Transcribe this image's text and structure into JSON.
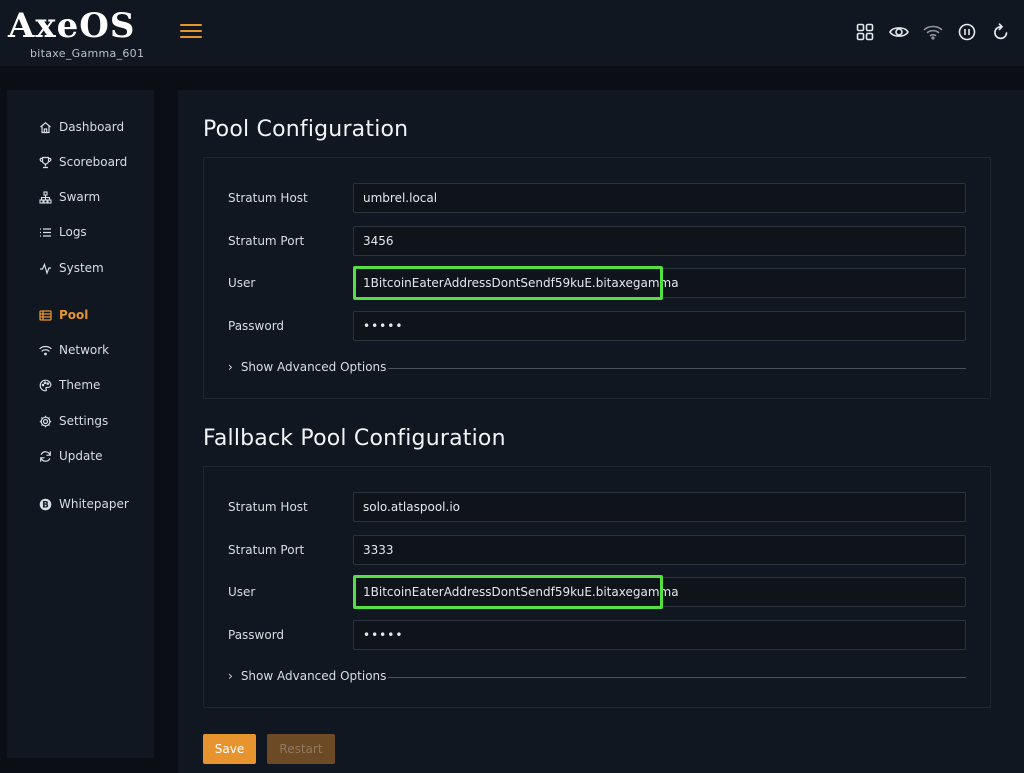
{
  "header": {
    "logo_text": "AxeOS",
    "device_name": "bitaxe_Gamma_601",
    "icons": [
      "menu-icon",
      "grid-icon",
      "eye-icon",
      "wifi-icon",
      "pause-icon",
      "refresh-icon"
    ]
  },
  "sidebar": {
    "items": [
      {
        "label": "Dashboard",
        "icon": "home-icon"
      },
      {
        "label": "Scoreboard",
        "icon": "trophy-icon"
      },
      {
        "label": "Swarm",
        "icon": "sitemap-icon"
      },
      {
        "label": "Logs",
        "icon": "list-icon"
      },
      {
        "label": "System",
        "icon": "activity-icon"
      },
      {
        "label": "Pool",
        "icon": "server-icon",
        "active": true
      },
      {
        "label": "Network",
        "icon": "wifi-icon"
      },
      {
        "label": "Theme",
        "icon": "palette-icon"
      },
      {
        "label": "Settings",
        "icon": "gear-icon"
      },
      {
        "label": "Update",
        "icon": "sync-icon"
      },
      {
        "label": "Whitepaper",
        "icon": "bitcoin-icon"
      }
    ]
  },
  "pool": {
    "title": "Pool Configuration",
    "stratum_host_label": "Stratum Host",
    "stratum_host": "umbrel.local",
    "stratum_port_label": "Stratum Port",
    "stratum_port": "3456",
    "user_label": "User",
    "user": "1BitcoinEaterAddressDontSendf59kuE.bitaxegamma",
    "password_label": "Password",
    "password": "•••••",
    "advanced_label": "Show Advanced Options"
  },
  "fallback": {
    "title": "Fallback Pool Configuration",
    "stratum_host_label": "Stratum Host",
    "stratum_host": "solo.atlaspool.io",
    "stratum_port_label": "Stratum Port",
    "stratum_port": "3333",
    "user_label": "User",
    "user": "1BitcoinEaterAddressDontSendf59kuE.bitaxegamma",
    "password_label": "Password",
    "password": "•••••",
    "advanced_label": "Show Advanced Options"
  },
  "actions": {
    "save_label": "Save",
    "restart_label": "Restart"
  },
  "colors": {
    "accent": "#e8942e",
    "highlight": "#52e043",
    "background": "#0b0f15",
    "panel": "#111720"
  }
}
